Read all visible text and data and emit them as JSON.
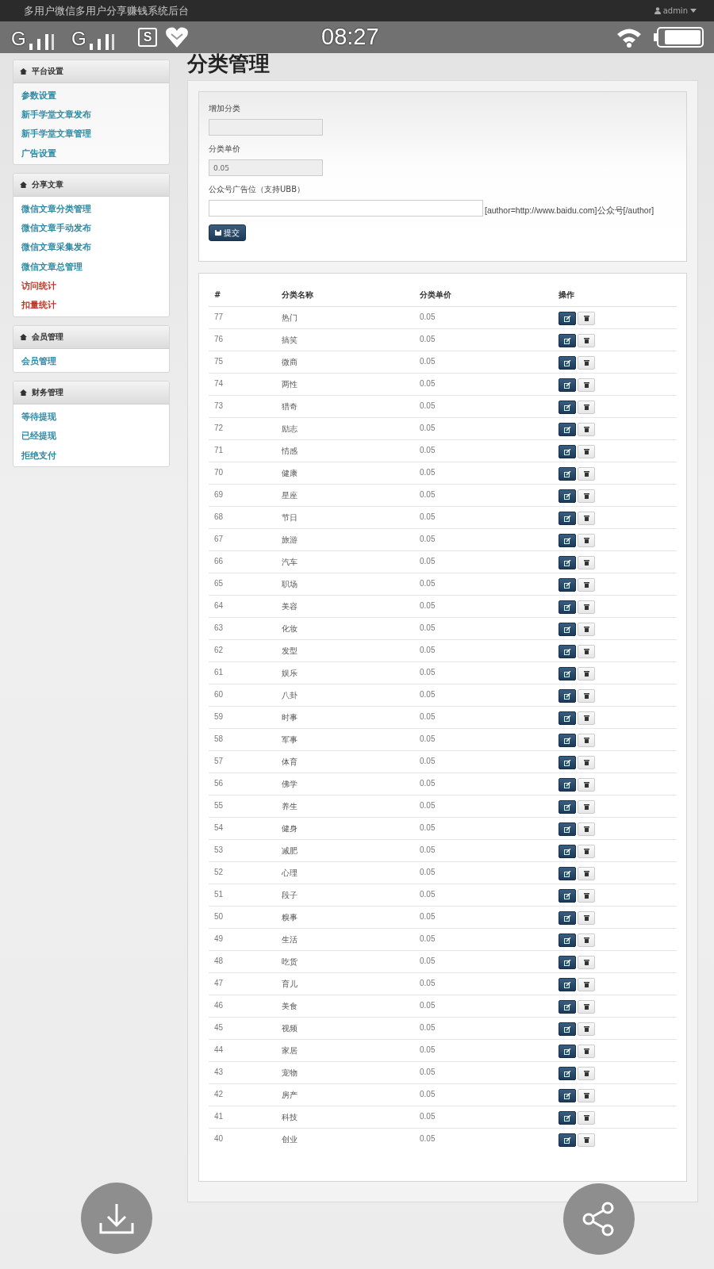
{
  "status_bar": {
    "signals": [
      "G",
      "G"
    ],
    "app_badge": "S",
    "time": "08:27"
  },
  "top_nav": {
    "title": "多用户微信多用户分享赚钱系统后台",
    "user": "admin"
  },
  "sidebar": {
    "sections": [
      {
        "title": "平台设置",
        "items": [
          {
            "label": "参数设置",
            "color": "#2f8aa3"
          },
          {
            "label": "新手学堂文章发布",
            "color": "#2f8aa3"
          },
          {
            "label": "新手学堂文章管理",
            "color": "#2f8aa3"
          },
          {
            "label": "广告设置",
            "color": "#2f8aa3"
          }
        ]
      },
      {
        "title": "分享文章",
        "items": [
          {
            "label": "微信文章分类管理",
            "color": "#2f8aa3"
          },
          {
            "label": "微信文章手动发布",
            "color": "#2f8aa3"
          },
          {
            "label": "微信文章采集发布",
            "color": "#2f8aa3"
          },
          {
            "label": "微信文章总管理",
            "color": "#2f8aa3"
          },
          {
            "label": "访问统计",
            "color": "#c0392b"
          },
          {
            "label": "扣量统计",
            "color": "#c0392b"
          }
        ]
      },
      {
        "title": "会员管理",
        "items": [
          {
            "label": "会员管理",
            "color": "#2f8aa3"
          }
        ]
      },
      {
        "title": "财务管理",
        "items": [
          {
            "label": "等待提现",
            "color": "#2f8aa3"
          },
          {
            "label": "已经提现",
            "color": "#2f8aa3"
          },
          {
            "label": "拒绝支付",
            "color": "#2f8aa3"
          }
        ]
      }
    ]
  },
  "page_title": "分类管理",
  "form": {
    "fields": [
      {
        "label": "增加分类",
        "kind": "short"
      },
      {
        "label": "分类单价",
        "kind": "short",
        "value": "0.05"
      },
      {
        "label": "公众号广告位（支持UBB）",
        "kind": "long",
        "hint": "[author=http://www.baidu.com]公众号[/author]"
      }
    ],
    "submit": "提交"
  },
  "table": {
    "columns": [
      "#",
      "分类名称",
      "分类单价",
      "操作"
    ],
    "rows": [
      {
        "id": "77",
        "name": "热门",
        "price": "0.05"
      },
      {
        "id": "76",
        "name": "搞笑",
        "price": "0.05"
      },
      {
        "id": "75",
        "name": "微商",
        "price": "0.05"
      },
      {
        "id": "74",
        "name": "两性",
        "price": "0.05"
      },
      {
        "id": "73",
        "name": "猎奇",
        "price": "0.05"
      },
      {
        "id": "72",
        "name": "励志",
        "price": "0.05"
      },
      {
        "id": "71",
        "name": "情感",
        "price": "0.05"
      },
      {
        "id": "70",
        "name": "健康",
        "price": "0.05"
      },
      {
        "id": "69",
        "name": "星座",
        "price": "0.05"
      },
      {
        "id": "68",
        "name": "节日",
        "price": "0.05"
      },
      {
        "id": "67",
        "name": "旅游",
        "price": "0.05"
      },
      {
        "id": "66",
        "name": "汽车",
        "price": "0.05"
      },
      {
        "id": "65",
        "name": "职场",
        "price": "0.05"
      },
      {
        "id": "64",
        "name": "美容",
        "price": "0.05"
      },
      {
        "id": "63",
        "name": "化妆",
        "price": "0.05"
      },
      {
        "id": "62",
        "name": "发型",
        "price": "0.05"
      },
      {
        "id": "61",
        "name": "娱乐",
        "price": "0.05"
      },
      {
        "id": "60",
        "name": "八卦",
        "price": "0.05"
      },
      {
        "id": "59",
        "name": "时事",
        "price": "0.05"
      },
      {
        "id": "58",
        "name": "军事",
        "price": "0.05"
      },
      {
        "id": "57",
        "name": "体育",
        "price": "0.05"
      },
      {
        "id": "56",
        "name": "佛学",
        "price": "0.05"
      },
      {
        "id": "55",
        "name": "养生",
        "price": "0.05"
      },
      {
        "id": "54",
        "name": "健身",
        "price": "0.05"
      },
      {
        "id": "53",
        "name": "减肥",
        "price": "0.05"
      },
      {
        "id": "52",
        "name": "心理",
        "price": "0.05"
      },
      {
        "id": "51",
        "name": "段子",
        "price": "0.05"
      },
      {
        "id": "50",
        "name": "糗事",
        "price": "0.05"
      },
      {
        "id": "49",
        "name": "生活",
        "price": "0.05"
      },
      {
        "id": "48",
        "name": "吃货",
        "price": "0.05"
      },
      {
        "id": "47",
        "name": "育儿",
        "price": "0.05"
      },
      {
        "id": "46",
        "name": "美食",
        "price": "0.05"
      },
      {
        "id": "45",
        "name": "视频",
        "price": "0.05"
      },
      {
        "id": "44",
        "name": "家居",
        "price": "0.05"
      },
      {
        "id": "43",
        "name": "宠物",
        "price": "0.05"
      },
      {
        "id": "42",
        "name": "房产",
        "price": "0.05"
      },
      {
        "id": "41",
        "name": "科技",
        "price": "0.05"
      },
      {
        "id": "40",
        "name": "创业",
        "price": "0.05"
      }
    ]
  }
}
